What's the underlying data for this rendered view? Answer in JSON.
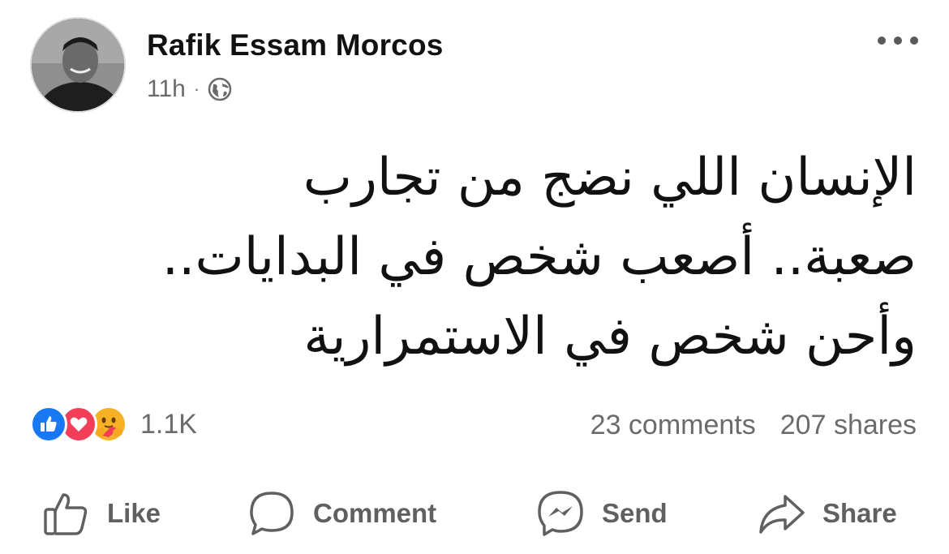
{
  "post": {
    "author": "Rafik Essam Morcos",
    "time": "11h",
    "separator": "·",
    "privacy_icon": "globe-icon",
    "menu_icon": "more-horizontal-icon",
    "text_lines": [
      "الإنسان اللي نضج من تجارب",
      "صعبة.. أصعب شخص في البدايات..",
      "وأحن شخص في الاستمرارية"
    ]
  },
  "engagement": {
    "reactions": [
      "like",
      "love",
      "care"
    ],
    "reaction_count": "1.1K",
    "comments": "23 comments",
    "shares": "207 shares"
  },
  "actions": {
    "like_label": "Like",
    "comment_label": "Comment",
    "send_label": "Send",
    "share_label": "Share"
  },
  "colors": {
    "like_blue": "#1877f2",
    "love_red": "#f33e58",
    "care_yellow": "#f7b125",
    "secondary_text": "#6b6b6b"
  }
}
